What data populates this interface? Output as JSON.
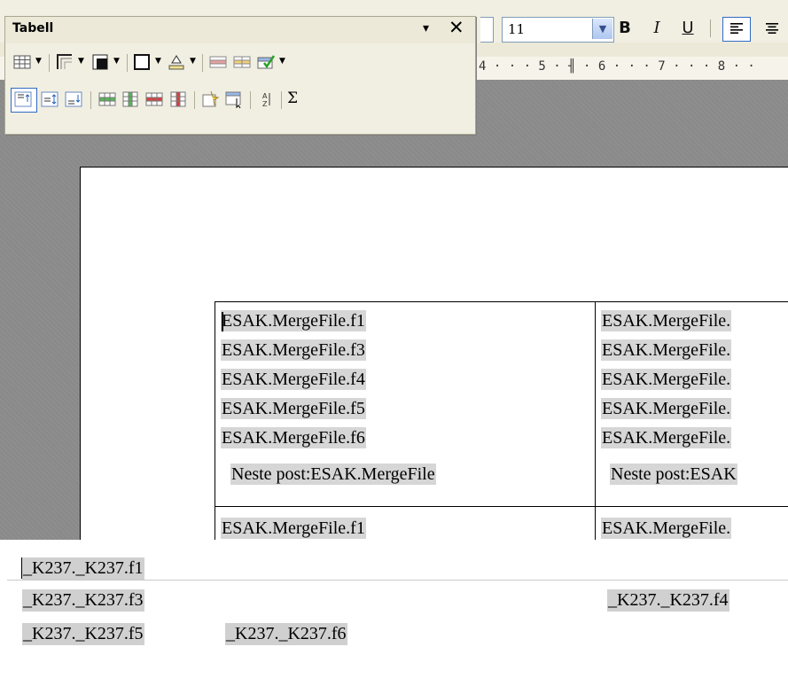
{
  "toolbar": {
    "font_size": "11",
    "bold_label": "B",
    "italic_label": "I",
    "underline_label": "U",
    "fontsize_dropdown_icon": "chevron-down-icon"
  },
  "ruler": {
    "text": "4 · · · 5 · ╢ · 6 · · · 7 · · · 8 · ·"
  },
  "tabell_toolbar": {
    "title": "Tabell",
    "menu_icon": "▾",
    "close_icon": "✕",
    "row1_icons": [
      "table-icon",
      "borders-icon",
      "border-style-icon",
      "border-color-icon",
      "background-color-icon",
      "merge-cells-icon",
      "split-cells-icon",
      "autoformat-icon"
    ],
    "row2_icons": [
      "align-top-icon",
      "align-center-icon",
      "align-bottom-icon",
      "insert-rows-icon",
      "insert-columns-icon",
      "delete-rows-icon",
      "delete-columns-icon",
      "select-table-icon",
      "select-cell-icon",
      "sort-icon",
      "sum-icon"
    ],
    "sum_label": "Σ"
  },
  "document": {
    "cells": [
      {
        "lines": [
          "ESAK.MergeFile.f1",
          "ESAK.MergeFile.f3",
          "ESAK.MergeFile.f4",
          "ESAK.MergeFile.f5",
          "ESAK.MergeFile.f6"
        ],
        "next": "Neste post:ESAK.MergeFile"
      },
      {
        "lines": [
          "ESAK.MergeFile.",
          "ESAK.MergeFile.",
          "ESAK.MergeFile.",
          "ESAK.MergeFile.",
          "ESAK.MergeFile."
        ],
        "next": "Neste post:ESAK"
      }
    ],
    "row2_col1": "ESAK.MergeFile.f1",
    "row2_col2": "ESAK.MergeFile."
  },
  "snippet": {
    "line1": "_K237._K237.f1",
    "line2": "_K237._K237.f3",
    "line2_right": "_K237._K237.f4",
    "line3a": "_K237._K237.f5",
    "line3b": "_K237._K237.f6"
  },
  "colors": {
    "field_shading": "#d6d6d6",
    "toolbar_bg": "#f1efe2",
    "workspace": "#8a8a8a"
  }
}
